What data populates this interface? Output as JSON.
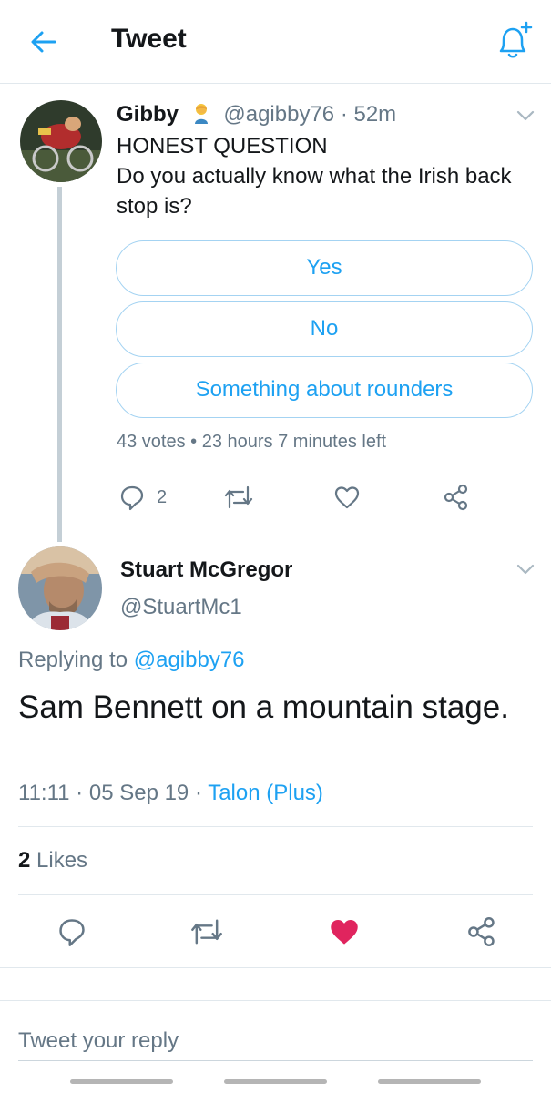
{
  "header": {
    "title": "Tweet"
  },
  "quoted_tweet": {
    "name": "Gibby",
    "handle": "@agibby76",
    "time": "52m",
    "text_line1": "HONEST QUESTION",
    "text_line2": "Do you actually know what the Irish back stop is?",
    "poll": {
      "options": [
        "Yes",
        "No",
        "Something about rounders"
      ],
      "votes": "43 votes",
      "time_left": "23 hours 7 minutes left"
    },
    "reply_count": "2"
  },
  "main_tweet": {
    "name": "Stuart McGregor",
    "handle": "@StuartMc1",
    "replying_prefix": "Replying to",
    "replying_to": "@agibby76",
    "text": "Sam Bennett on a mountain stage.",
    "time": "11:11",
    "date": "05 Sep 19",
    "client": "Talon (Plus)",
    "likes_count": "2",
    "likes_label": "Likes"
  },
  "reply": {
    "placeholder": "Tweet your reply"
  },
  "colors": {
    "accent": "#1da1f2",
    "like": "#e0245e",
    "muted": "#657786"
  }
}
